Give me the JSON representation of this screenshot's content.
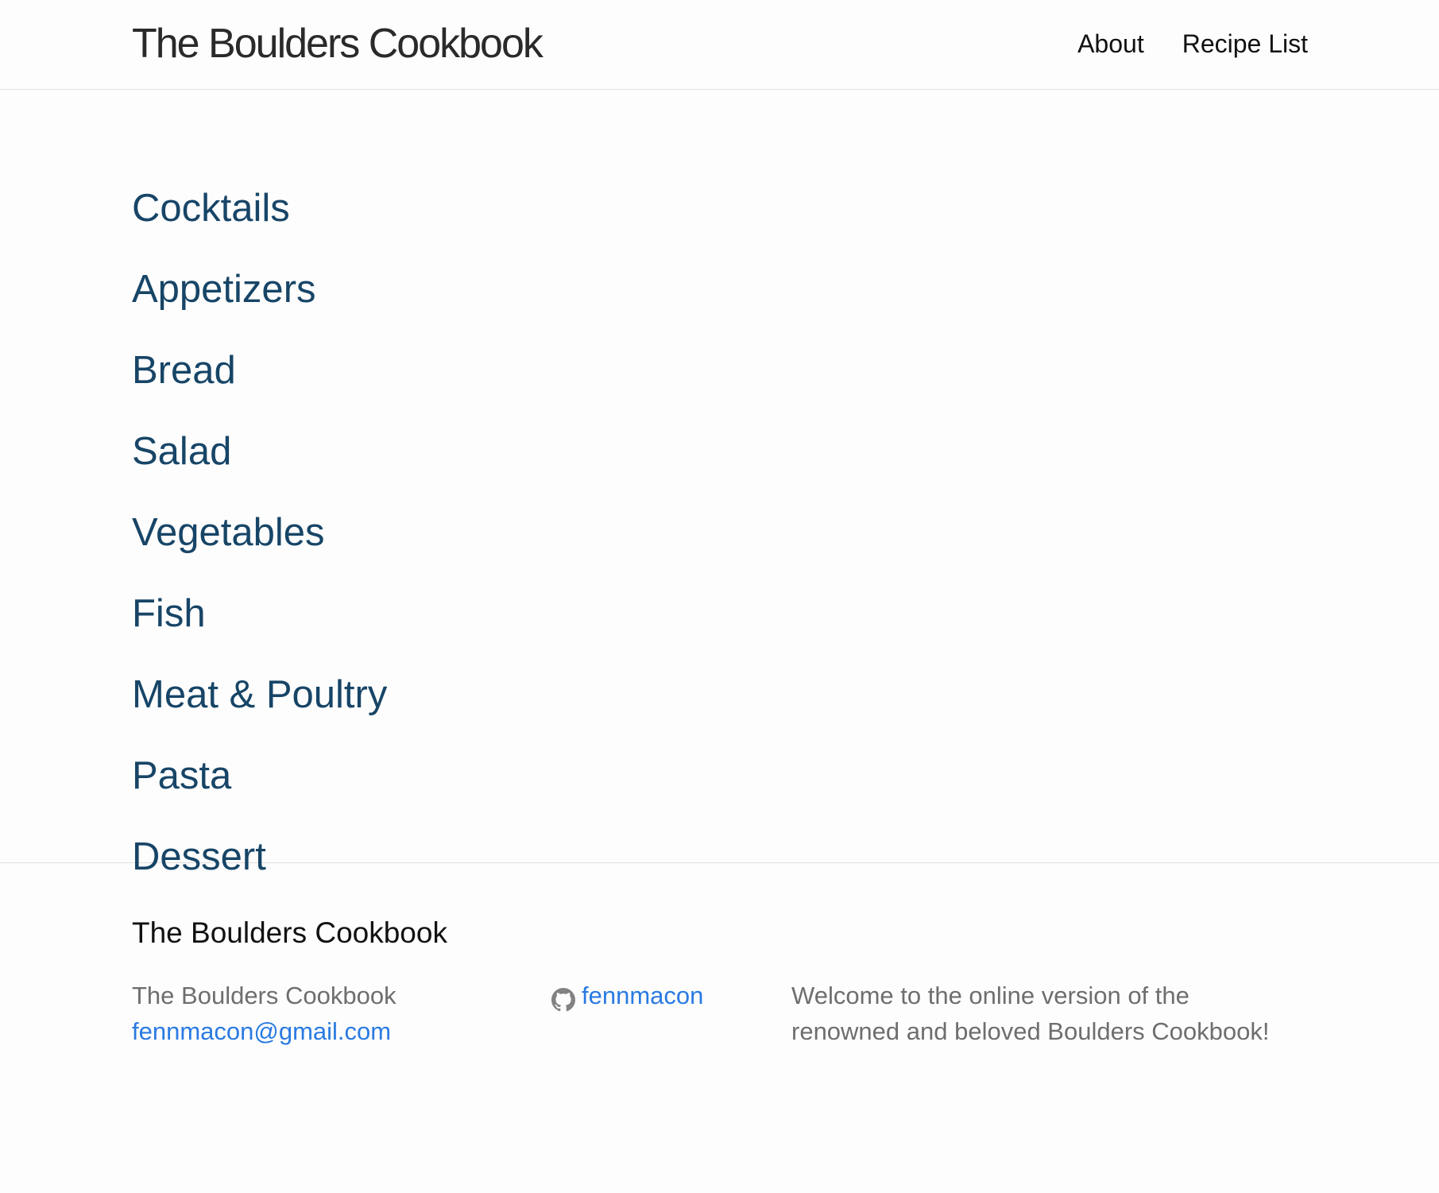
{
  "header": {
    "site_title": "The Boulders Cookbook",
    "nav": [
      {
        "label": "About"
      },
      {
        "label": "Recipe List"
      }
    ]
  },
  "categories": [
    {
      "label": "Cocktails"
    },
    {
      "label": "Appetizers"
    },
    {
      "label": "Bread"
    },
    {
      "label": "Salad"
    },
    {
      "label": "Vegetables"
    },
    {
      "label": "Fish"
    },
    {
      "label": "Meat & Poultry"
    },
    {
      "label": "Pasta"
    },
    {
      "label": "Dessert"
    }
  ],
  "footer": {
    "heading": "The Boulders Cookbook",
    "col1": {
      "name": "The Boulders Cookbook",
      "email": "fennmacon@gmail.com"
    },
    "col2": {
      "github_icon": "github-icon",
      "github_user": "fennmacon"
    },
    "col3": {
      "description": "Welcome to the online version of the renowned and beloved Boulders Cookbook!"
    }
  },
  "colors": {
    "category_link": "#174567",
    "footer_link": "#2a7ae2",
    "muted_text": "#6e6e6e",
    "divider": "#e0e0e0"
  }
}
